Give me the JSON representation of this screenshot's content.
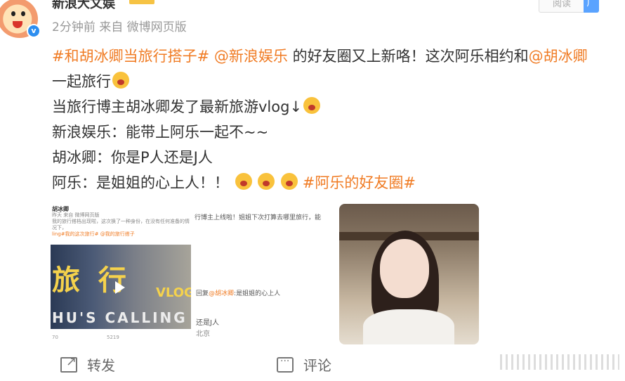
{
  "header": {
    "username": "新浪大文娱",
    "meta": "2分钟前  来自 微博网页版",
    "read_label": "阅读",
    "ad_label": "广"
  },
  "post": {
    "line1_tag1": "#和胡冰卿当旅行搭子#",
    "line1_mention1": "@新浪娱乐",
    "line1_text": "的好友圈又上新咯！这次阿乐相约和",
    "line1_mention2": "@胡冰卿",
    "line2_text": "一起旅行",
    "line3_text": "当旅行博主胡冰卿发了最新旅游vlog↓",
    "line4_text": "新浪娱乐：能带上阿乐一起不~~",
    "line5_text": "胡冰卿：你是P人还是J人",
    "line6_text": "阿乐：是姐姐的心上人！！",
    "line6_tag": "#阿乐的好友圈#"
  },
  "images": {
    "img1": {
      "name": "胡冰卿",
      "meta": "昨天 来自 微博网页版",
      "caption1": "我的旅行搭档出现啦，这次换了一种身份，在没有任何准备的情况下，",
      "caption2": "ling#我的这次旅行#  @我的旅行搭子",
      "big_text": "旅 行",
      "vlog": "VLOG",
      "calling": "HU'S  CALLING",
      "stat1": "70",
      "stat2": "5219"
    },
    "img2": {
      "line1": "行博主上线啦！姐姐下次打算去哪里旅行，能",
      "reply_prefix": "回复",
      "reply_mention": "@胡冰卿",
      "reply_text": ":是姐姐的心上人",
      "line3": "还是J人",
      "location": "北京"
    }
  },
  "actions": {
    "share": "转发",
    "comment": "评论"
  }
}
